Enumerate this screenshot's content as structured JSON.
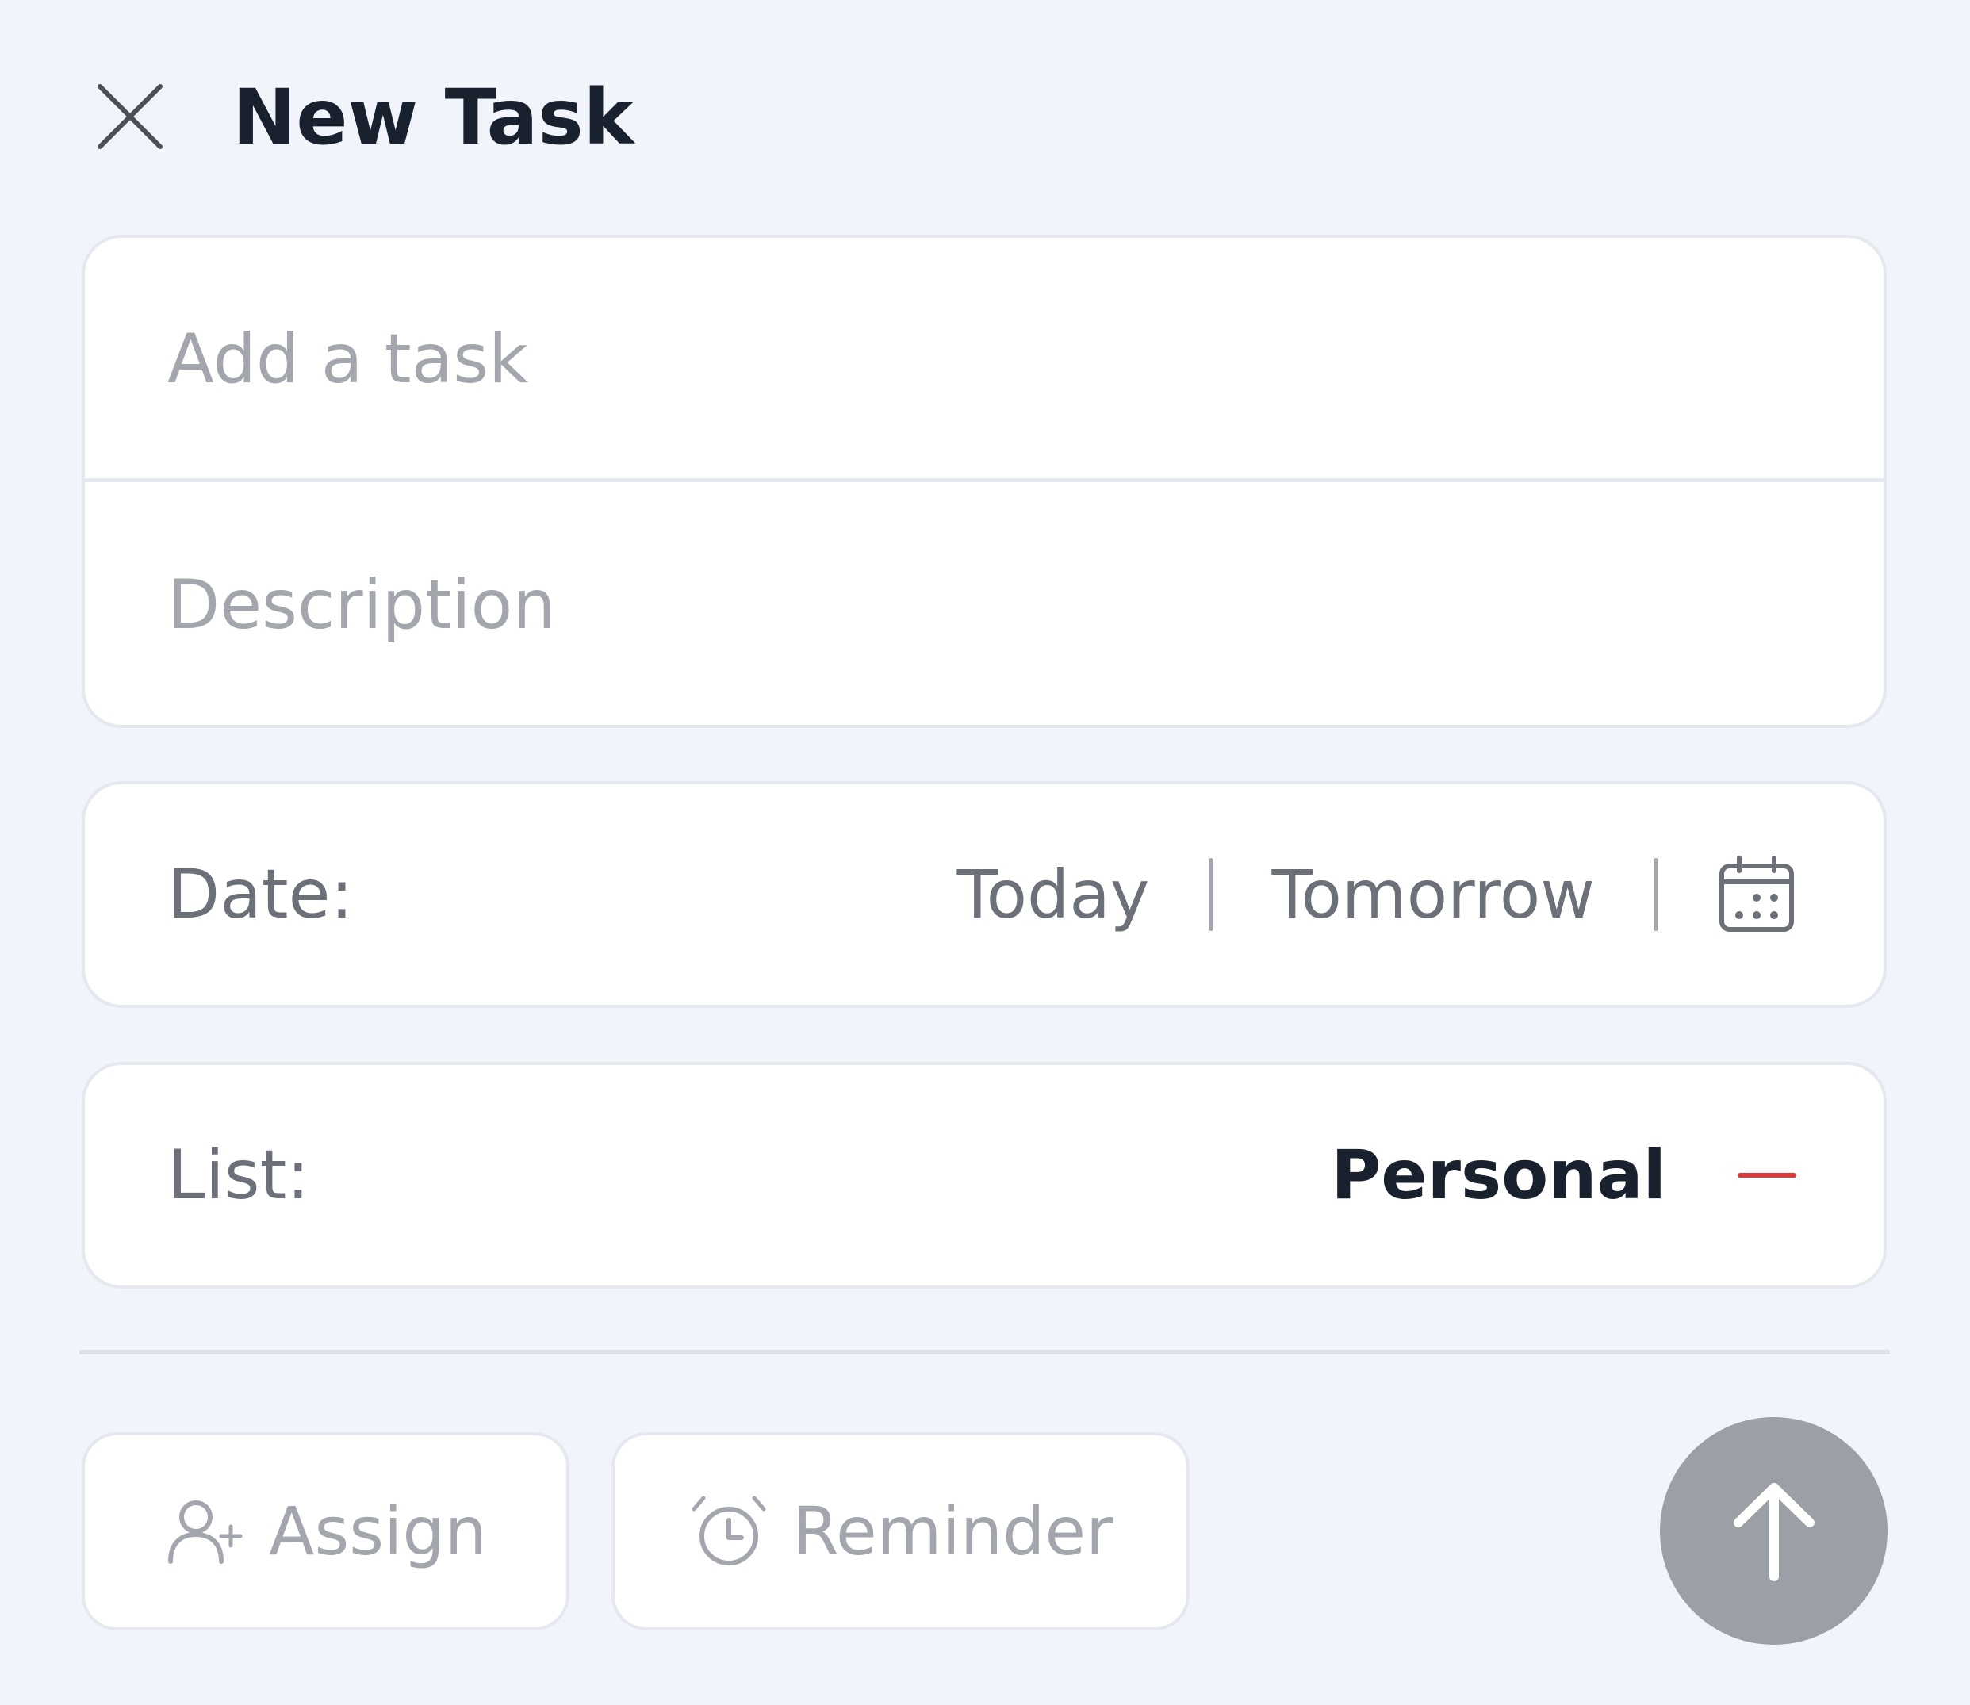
{
  "header": {
    "title": "New Task",
    "close_icon": "close-icon"
  },
  "task_form": {
    "task_placeholder": "Add a task",
    "task_value": "",
    "description_placeholder": "Description",
    "description_value": ""
  },
  "date_row": {
    "label": "Date:",
    "options": [
      "Today",
      "Tomorrow"
    ],
    "calendar_icon": "calendar-icon"
  },
  "list_row": {
    "label": "List:",
    "value": "Personal",
    "color": "#d93a3a"
  },
  "actions": {
    "assign_label": "Assign",
    "assign_icon": "add-user-icon",
    "reminder_label": "Reminder",
    "reminder_icon": "alarm-clock-icon",
    "submit_icon": "arrow-up-icon"
  },
  "colors": {
    "background": "#f2f4fb",
    "card": "#ffffff",
    "border": "#e6e8ef",
    "text_primary": "#1a212e",
    "text_secondary": "#6c7079",
    "placeholder": "#a3a7ad",
    "submit_button": "#9b9fa6"
  }
}
